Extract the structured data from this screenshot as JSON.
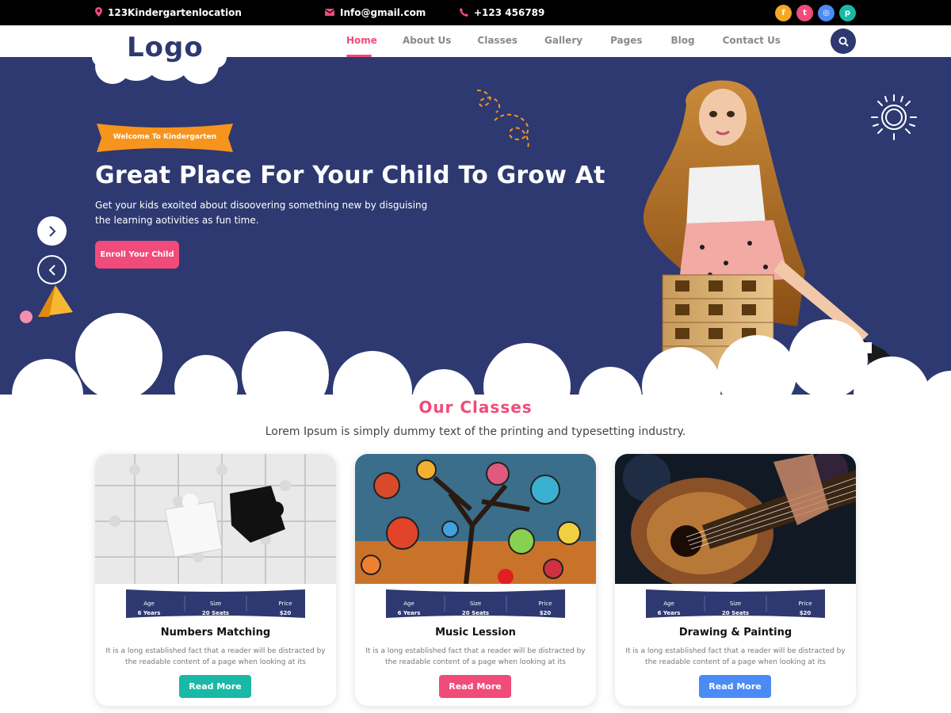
{
  "topbar": {
    "location": "123Kindergartenlocation",
    "email": "Info@gmail.com",
    "phone": "+123 456789",
    "social": [
      {
        "name": "facebook-icon",
        "color": "#f5a623",
        "glyph": "f"
      },
      {
        "name": "twitter-icon",
        "color": "#f04b7a",
        "glyph": "t"
      },
      {
        "name": "instagram-icon",
        "color": "#4b8bf5",
        "glyph": "◎"
      },
      {
        "name": "pinterest-icon",
        "color": "#19b9a5",
        "glyph": "p"
      }
    ]
  },
  "nav": {
    "logo": "Logo",
    "items": [
      "Home",
      "About Us",
      "Classes",
      "Gallery",
      "Pages",
      "Blog",
      "Contact Us"
    ],
    "active": "Home"
  },
  "hero": {
    "badge": "Welcome To Kindergarten",
    "title": "Great Place For Your Child To Grow At",
    "subtitle": "Get your kids exoited about disoovering something new by disguising the learning aotivities as fun time.",
    "cta": "Enroll Your Child"
  },
  "classes": {
    "title": "Our Classes",
    "subtitle": "Lorem Ipsum is simply dummy text of the printing and typesetting industry.",
    "cards": [
      {
        "title": "Numbers Matching",
        "age_label": "Age",
        "age": "6 Years",
        "size_label": "Size",
        "size": "20 Seats",
        "price_label": "Price",
        "price": "$20",
        "desc": "It is a long established fact that a reader will be distracted by the readable content of a page when looking at its",
        "button": "Read More",
        "button_color": "#19b9a5"
      },
      {
        "title": "Music Lession",
        "age_label": "Age",
        "age": "6 Years",
        "size_label": "Size",
        "size": "20 Seats",
        "price_label": "Price",
        "price": "$20",
        "desc": "It is a long established fact that a reader will be distracted by the readable content of a page when looking at its",
        "button": "Read More",
        "button_color": "#f04b7a"
      },
      {
        "title": "Drawing & Painting",
        "age_label": "Age",
        "age": "6 Years",
        "size_label": "Size",
        "size": "20 Seats",
        "price_label": "Price",
        "price": "$20",
        "desc": "It is a long established fact that a reader will be distracted by the readable content of a page when looking at its",
        "button": "Read More",
        "button_color": "#4b8bf5"
      }
    ]
  },
  "colors": {
    "navy": "#2d3970",
    "pink": "#f04b7a",
    "orange": "#f7941d"
  }
}
